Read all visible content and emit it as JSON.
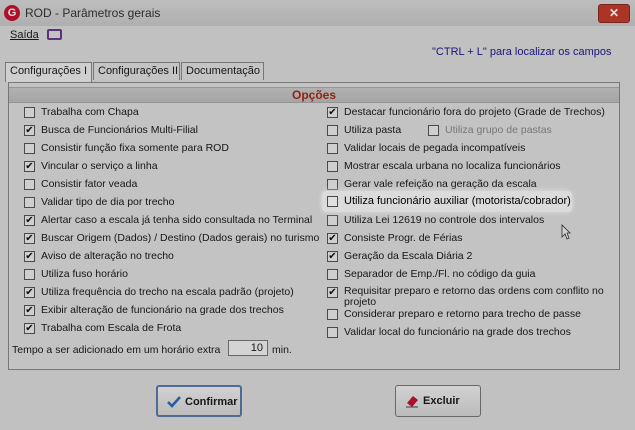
{
  "window": {
    "title": "ROD - Parâmetros gerais",
    "app_icon_letter": "G",
    "close_glyph": "✕"
  },
  "menu": {
    "saida": "Saída"
  },
  "hint": "\"CTRL + L\" para localizar os campos",
  "tabs": [
    {
      "label": "Configurações I"
    },
    {
      "label": "Configurações II"
    },
    {
      "label": "Documentação"
    }
  ],
  "panel": {
    "header": "Opções"
  },
  "left_options": [
    {
      "label": "Trabalha com Chapa",
      "checked": false
    },
    {
      "label": "Busca de Funcionários Multi-Filial",
      "checked": true
    },
    {
      "label": "Consistir função fixa somente para ROD",
      "checked": false
    },
    {
      "label": "Vincular o serviço a linha",
      "checked": true
    },
    {
      "label": "Consistir fator veada",
      "checked": false
    },
    {
      "label": "Validar tipo de dia por trecho",
      "checked": false
    },
    {
      "label": "Alertar caso a escala já tenha sido consultada no Terminal",
      "checked": true
    },
    {
      "label": "Buscar Origem (Dados) / Destino (Dados gerais) no turismo",
      "checked": true
    },
    {
      "label": "Aviso de alteração no trecho",
      "checked": true
    },
    {
      "label": "Utiliza fuso horário",
      "checked": false
    },
    {
      "label": "Utiliza frequência do trecho na escala padrão (projeto)",
      "checked": true
    },
    {
      "label": "Exibir alteração de funcionário na grade dos trechos",
      "checked": true
    },
    {
      "label": "Trabalha com Escala de Frota",
      "checked": true
    }
  ],
  "right_options": [
    {
      "label": "Destacar funcionário fora do projeto (Grade de Trechos)",
      "checked": true
    },
    {
      "label": "Utiliza pasta",
      "checked": false
    },
    {
      "label": "Validar locais de pegada incompatíveis",
      "checked": false
    },
    {
      "label": "Mostrar escala urbana no localiza funcionários",
      "checked": false
    },
    {
      "label": "Gerar vale refeição na geração da escala",
      "checked": false
    },
    {
      "label": "Utiliza funcionário auxiliar (motorista/cobrador)",
      "checked": false
    },
    {
      "label": "Utiliza Lei 12619 no controle dos intervalos",
      "checked": false
    },
    {
      "label": "Consiste Progr. de Férias",
      "checked": true
    },
    {
      "label": "Geração da Escala Diária 2",
      "checked": true
    },
    {
      "label": "Separador de Emp./Fl. no código da guia",
      "checked": false
    },
    {
      "label": "Requisitar preparo e retorno das ordens com conflito no projeto",
      "checked": true
    },
    {
      "label": "Considerar preparo e retorno para trecho de passe",
      "checked": false
    },
    {
      "label": "Validar local do funcionário na grade dos trechos",
      "checked": false
    }
  ],
  "sub_option": {
    "label": "Utiliza grupo de pastas",
    "checked": false
  },
  "tempo": {
    "label": "Tempo a ser adicionado em um horário extra",
    "value": "10",
    "unit": "min."
  },
  "buttons": {
    "confirm": "Confirmar",
    "cancel": "Excluir"
  },
  "colors": {
    "header_text": "#a52a10",
    "hint_text": "#1b1b8a",
    "close_button": "#c43c2c"
  }
}
